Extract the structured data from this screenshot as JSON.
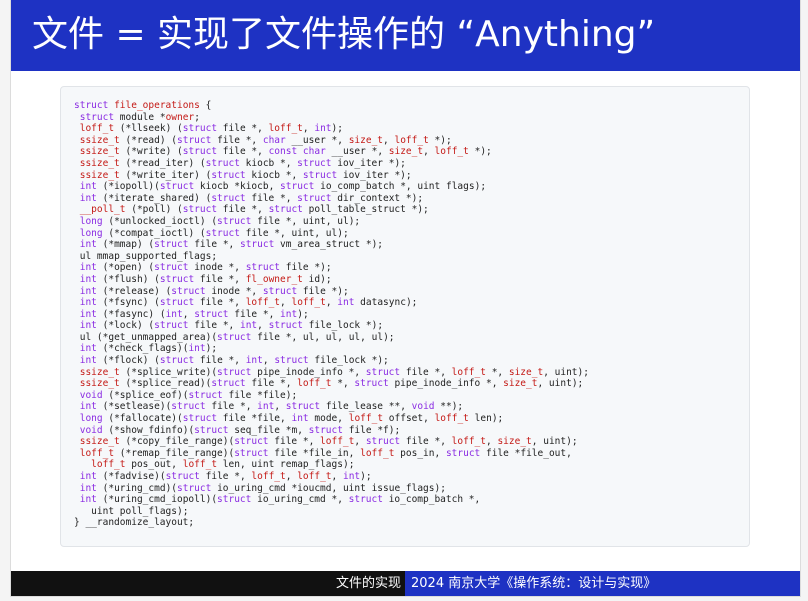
{
  "title": "文件 = 实现了文件操作的 “Anything”",
  "code_lines": [
    "struct file_operations {",
    " struct module *owner;",
    " loff_t (*llseek) (struct file *, loff_t, int);",
    " ssize_t (*read) (struct file *, char __user *, size_t, loff_t *);",
    " ssize_t (*write) (struct file *, const char __user *, size_t, loff_t *);",
    " ssize_t (*read_iter) (struct kiocb *, struct iov_iter *);",
    " ssize_t (*write_iter) (struct kiocb *, struct iov_iter *);",
    " int (*iopoll)(struct kiocb *kiocb, struct io_comp_batch *, uint flags);",
    " int (*iterate_shared) (struct file *, struct dir_context *);",
    " __poll_t (*poll) (struct file *, struct poll_table_struct *);",
    " long (*unlocked_ioctl) (struct file *, uint, ul);",
    " long (*compat_ioctl) (struct file *, uint, ul);",
    " int (*mmap) (struct file *, struct vm_area_struct *);",
    " ul mmap_supported_flags;",
    " int (*open) (struct inode *, struct file *);",
    " int (*flush) (struct file *, fl_owner_t id);",
    " int (*release) (struct inode *, struct file *);",
    " int (*fsync) (struct file *, loff_t, loff_t, int datasync);",
    " int (*fasync) (int, struct file *, int);",
    " int (*lock) (struct file *, int, struct file_lock *);",
    " ul (*get_unmapped_area)(struct file *, ul, ul, ul, ul);",
    " int (*check_flags)(int);",
    " int (*flock) (struct file *, int, struct file_lock *);",
    " ssize_t (*splice_write)(struct pipe_inode_info *, struct file *, loff_t *, size_t, uint);",
    " ssize_t (*splice_read)(struct file *, loff_t *, struct pipe_inode_info *, size_t, uint);",
    " void (*splice_eof)(struct file *file);",
    " int (*setlease)(struct file *, int, struct file_lease **, void **);",
    " long (*fallocate)(struct file *file, int mode, loff_t offset, loff_t len);",
    " void (*show_fdinfo)(struct seq_file *m, struct file *f);",
    " ssize_t (*copy_file_range)(struct file *, loff_t, struct file *, loff_t, size_t, uint);",
    " loff_t (*remap_file_range)(struct file *file_in, loff_t pos_in, struct file *file_out,",
    "   loff_t pos_out, loff_t len, uint remap_flags);",
    " int (*fadvise)(struct file *, loff_t, loff_t, int);",
    " int (*uring_cmd)(struct io_uring_cmd *ioucmd, uint issue_flags);",
    " int (*uring_cmd_iopoll)(struct io_uring_cmd *, struct io_comp_batch *,",
    "   uint poll_flags);",
    "} __randomize_layout;"
  ],
  "footer": {
    "section": "文件的实现",
    "course": "2024 南京大学《操作系统：设计与实现》"
  },
  "colors": {
    "brand_blue": "#1e32c3",
    "footer_dark": "#111111",
    "keyword": "#8a2be2",
    "type": "#c41a16",
    "text": "#222222"
  }
}
